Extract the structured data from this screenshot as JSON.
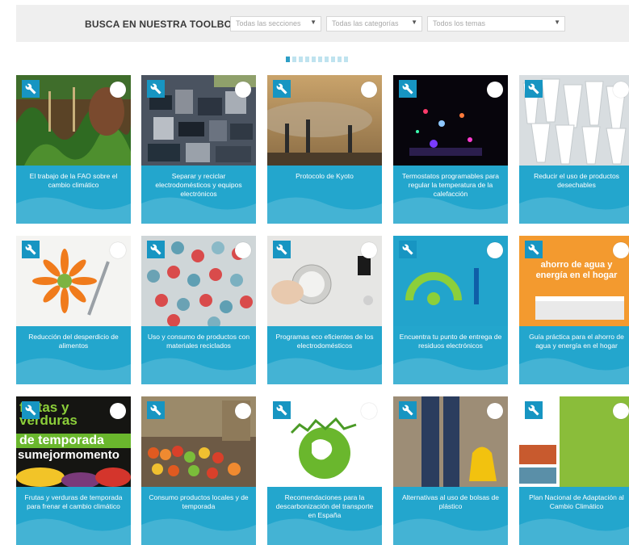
{
  "search": {
    "label": "BUSCA EN NUESTRA TOOLBOX",
    "section_select": "Todas las secciones",
    "category_select": "Todas las categorías",
    "topic_select": "Todos los temas"
  },
  "pagination": {
    "count": 10,
    "active_index": 0
  },
  "cards": [
    {
      "label": "El trabajo de la FAO sobre el cambio climático",
      "image": "garden-photo"
    },
    {
      "label": "Separar y reciclar electrodomésticos y equipos electrónicos",
      "image": "electronics-pile-photo"
    },
    {
      "label": "Protocolo de Kyoto",
      "image": "smokestacks-photo"
    },
    {
      "label": "Termostatos programables para regular la temperatura de la calefacción",
      "image": "dark-lights-photo"
    },
    {
      "label": "Reducir el uso de productos desechables",
      "image": "white-cups-photo"
    },
    {
      "label": "Reducción del desperdicio de alimentos",
      "image": "carrot-flower-photo"
    },
    {
      "label": "Uso y consumo de productos con materiales reciclados",
      "image": "buttons-photo"
    },
    {
      "label": "Programas eco eficientes de los electrodomésticos",
      "image": "appliance-knob-photo"
    },
    {
      "label": "Encuentra tu punto de entrega de residuos electrónicos",
      "image": "recycling-graphic"
    },
    {
      "label": "Guía práctica para el ahorro de agua y energía en el hogar",
      "image": "guide-cover",
      "cover_text": "ahorro de agua y energía en el hogar"
    },
    {
      "label": "Frutas y verduras de temporada para frenar el cambio climático",
      "image": "seasonal-produce",
      "cover_lines": [
        "frutas y",
        "verduras",
        "de temporada",
        "sumejormomento"
      ]
    },
    {
      "label": "Consumo productos locales y de temporada",
      "image": "market-produce-photo"
    },
    {
      "label": "Recomendaciones para la descarbonización del transporte en España",
      "image": "green-globe-graphic"
    },
    {
      "label": "Alternativas al uso de bolsas de plástico",
      "image": "shopping-bag-photo"
    },
    {
      "label": "Plan Nacional de Adaptación al Cambio Climático",
      "image": "plan-cover"
    }
  ]
}
